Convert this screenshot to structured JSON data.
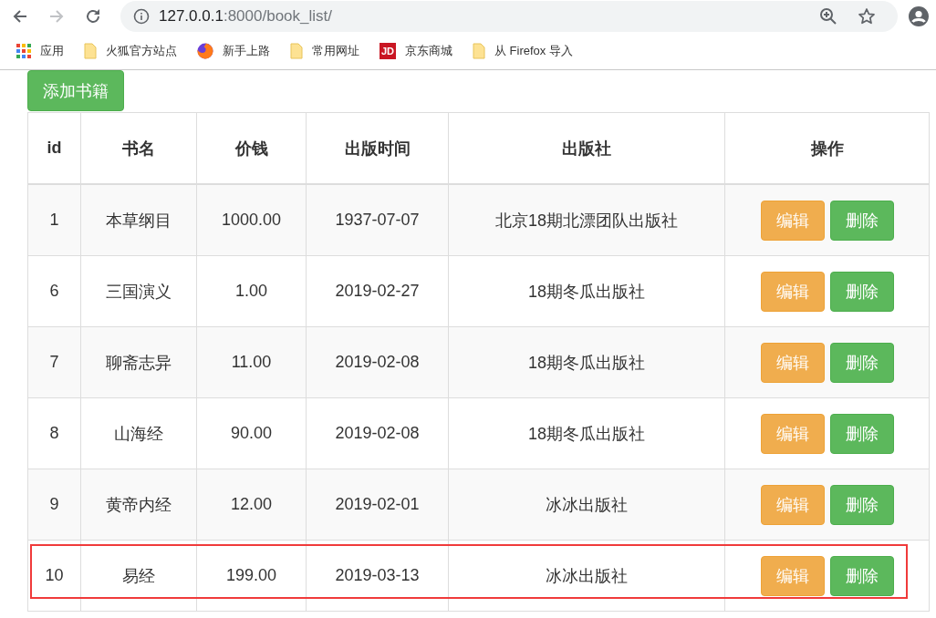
{
  "browser": {
    "back_enabled": true,
    "forward_enabled": false,
    "url_host": "127.0.0.1",
    "url_path": ":8000/book_list/",
    "bookmarks": [
      {
        "kind": "apps",
        "label": "应用"
      },
      {
        "kind": "folder",
        "label": "火狐官方站点"
      },
      {
        "kind": "firefox",
        "label": "新手上路"
      },
      {
        "kind": "folder",
        "label": "常用网址"
      },
      {
        "kind": "jd",
        "icon_text": "JD",
        "label": "京东商城"
      },
      {
        "kind": "folder",
        "label": "从 Firefox 导入"
      }
    ]
  },
  "add_button": "添加书籍",
  "table": {
    "columns": [
      "id",
      "书名",
      "价钱",
      "出版时间",
      "出版社",
      "操作"
    ],
    "rows": [
      {
        "cells": [
          "1",
          "本草纲目",
          "1000.00",
          "1937-07-07",
          "北京18期北漂团队出版社"
        ],
        "actions": [
          "编辑",
          "删除"
        ],
        "highlighted": false
      },
      {
        "cells": [
          "6",
          "三国演义",
          "1.00",
          "2019-02-27",
          "18期冬瓜出版社"
        ],
        "actions": [
          "编辑",
          "删除"
        ],
        "highlighted": false
      },
      {
        "cells": [
          "7",
          "聊斋志异",
          "11.00",
          "2019-02-08",
          "18期冬瓜出版社"
        ],
        "actions": [
          "编辑",
          "删除"
        ],
        "highlighted": false
      },
      {
        "cells": [
          "8",
          "山海经",
          "90.00",
          "2019-02-08",
          "18期冬瓜出版社"
        ],
        "actions": [
          "编辑",
          "删除"
        ],
        "highlighted": false
      },
      {
        "cells": [
          "9",
          "黄帝内经",
          "12.00",
          "2019-02-01",
          "冰冰出版社"
        ],
        "actions": [
          "编辑",
          "删除"
        ],
        "highlighted": false
      },
      {
        "cells": [
          "10",
          "易经",
          "199.00",
          "2019-03-13",
          "冰冰出版社"
        ],
        "actions": [
          "编辑",
          "删除"
        ],
        "highlighted": true
      }
    ]
  }
}
